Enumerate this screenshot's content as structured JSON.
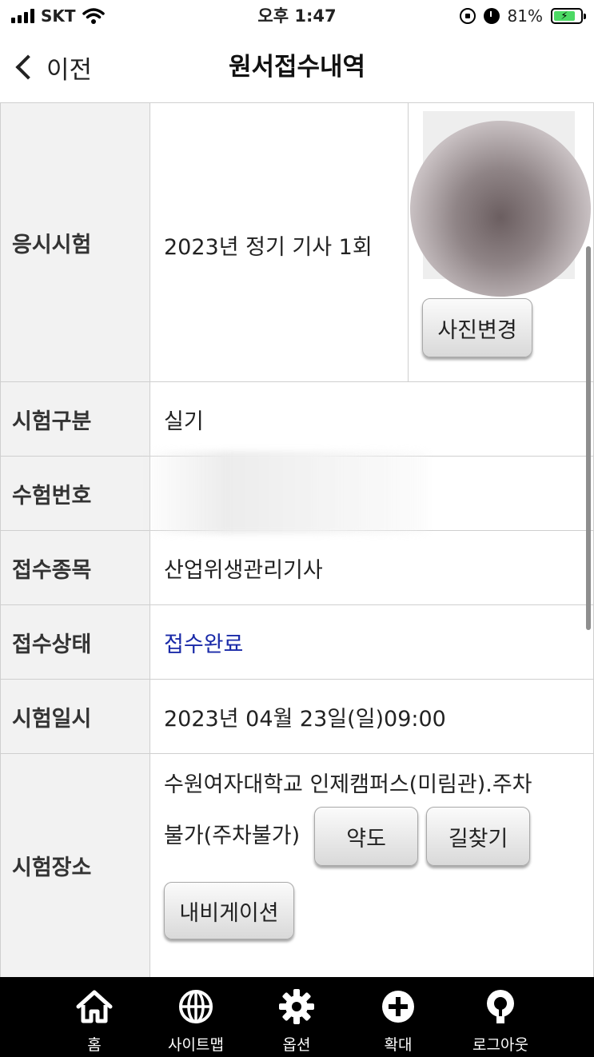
{
  "status_bar": {
    "carrier": "SKT",
    "time": "오후 1:47",
    "battery_percent": "81%",
    "battery_level": 0.81,
    "battery_color": "#4cd964",
    "icons": [
      "signal-icon",
      "wifi-icon",
      "rotation-lock-icon",
      "alarm-icon",
      "battery-charging-icon"
    ]
  },
  "nav": {
    "back_label": "이전",
    "title": "원서접수내역"
  },
  "rows": {
    "exam": {
      "label": "응시시험",
      "value": "2023년 정기 기사 1회"
    },
    "category": {
      "label": "시험구분",
      "value": "실기"
    },
    "number": {
      "label": "수험번호",
      "value": ""
    },
    "subject": {
      "label": "접수종목",
      "value": "산업위생관리기사"
    },
    "state": {
      "label": "접수상태",
      "value": "접수완료",
      "color": "#1a2aa8"
    },
    "datetime": {
      "label": "시험일시",
      "value": "2023년 04월 23일(일)09:00"
    },
    "place": {
      "label": "시험장소",
      "line1": "수원여자대학교 인제캠퍼스(미림관).주차",
      "line2": "불가(주차불가)"
    }
  },
  "buttons": {
    "photo_change": "사진변경",
    "map": "약도",
    "route": "길찾기",
    "navigation": "내비게이션"
  },
  "bottom_tabs": [
    {
      "label": "홈",
      "icon": "home-icon"
    },
    {
      "label": "사이트맵",
      "icon": "globe-icon"
    },
    {
      "label": "옵션",
      "icon": "gear-icon"
    },
    {
      "label": "확대",
      "icon": "plus-circle-icon"
    },
    {
      "label": "로그아웃",
      "icon": "logout-icon"
    }
  ]
}
